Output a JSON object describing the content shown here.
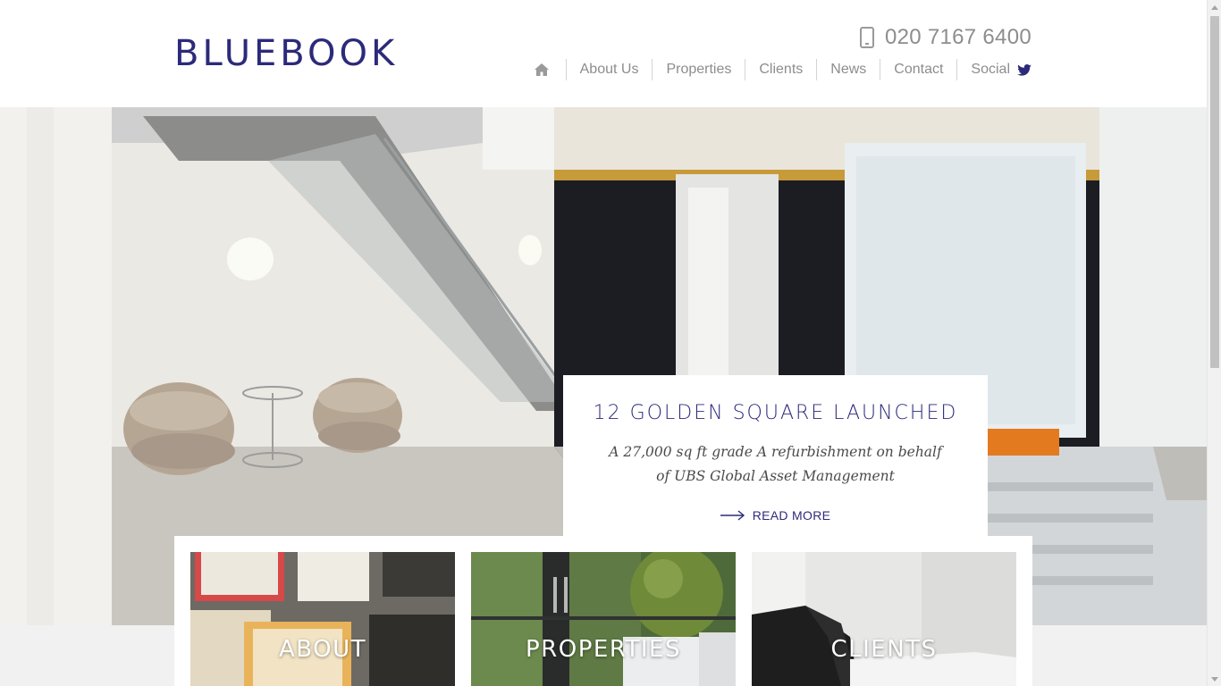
{
  "brand": {
    "logo": "BLUEBOOK",
    "color": "#2c2a7a"
  },
  "contact": {
    "phone": "020 7167 6400",
    "icon": "mobile-phone-icon"
  },
  "nav": {
    "home_icon": "home-icon",
    "items": [
      {
        "label": "About Us"
      },
      {
        "label": "Properties"
      },
      {
        "label": "Clients"
      },
      {
        "label": "News"
      },
      {
        "label": "Contact"
      },
      {
        "label": "Social",
        "icon": "twitter-icon"
      }
    ]
  },
  "feature": {
    "title": "12 GOLDEN SQUARE LAUNCHED",
    "description": "A 27,000 sq ft grade A refurbishment on behalf of UBS Global Asset Management",
    "link_label": "READ MORE",
    "link_icon": "arrow-right-icon"
  },
  "tiles": [
    {
      "label": "ABOUT"
    },
    {
      "label": "PROPERTIES"
    },
    {
      "label": "CLIENTS"
    }
  ]
}
